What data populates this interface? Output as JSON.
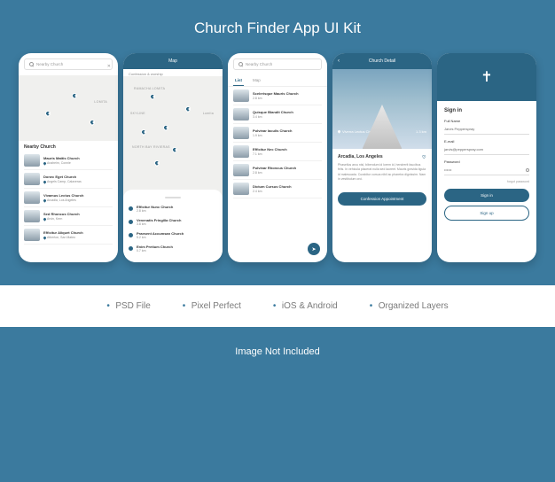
{
  "colors": {
    "brand": "#2b6584",
    "bg": "#3b7a9e"
  },
  "title": "Church Finder App UI Kit",
  "features": [
    "PSD File",
    "Pixel Perfect",
    "iOS & Android",
    "Organized Layers"
  ],
  "not_included": "Image Not Included",
  "screen1": {
    "search_placeholder": "Nearby Church",
    "section": "Nearby Church",
    "map_labels": [
      "LOMITA"
    ],
    "items": [
      {
        "name": "Mauris Mattis Church",
        "sub": "Anaheim, Connie"
      },
      {
        "name": "Donec Eget Church",
        "sub": "Angels Camp, Calaveras"
      },
      {
        "name": "Vivamus Lectus Church",
        "sub": "Arcadia, Los Angeles"
      },
      {
        "name": "Sed Rhoncus Church",
        "sub": "Arvin, Kern"
      },
      {
        "name": "Efficitur Aliquet Church",
        "sub": "Atherton, San Mateo"
      }
    ]
  },
  "screen2": {
    "header": "Map",
    "sub": "Confession & worship",
    "map_labels": [
      "RAMACHA LOMITA",
      "SKYLINE",
      "Lomita",
      "NORTH BAY RIVIERAS"
    ],
    "items": [
      {
        "name": "Efficitur Nunc Church",
        "dist": "2.8 km"
      },
      {
        "name": "Venenatis Fringilla Church",
        "dist": "3.8 km"
      },
      {
        "name": "Praesent Accumsan Church",
        "dist": "5.2 km"
      },
      {
        "name": "Enim Pretium Church",
        "dist": "0.7 km"
      }
    ]
  },
  "screen3": {
    "search_placeholder": "Nearby Church",
    "tabs": [
      "List",
      "Map"
    ],
    "items": [
      {
        "name": "Scelerisque Mauris Church",
        "dist": "2.8 km"
      },
      {
        "name": "Quisque Blandit Church",
        "dist": "3.4 km"
      },
      {
        "name": "Pulvinar Iaculis Church",
        "dist": "1.9 km"
      },
      {
        "name": "Efficitur Nec Church",
        "dist": "7.1 km"
      },
      {
        "name": "Pulvinar Rhoncus Church",
        "dist": "2.8 km"
      },
      {
        "name": "Dictum Cursus Church",
        "dist": "2.4 km"
      }
    ]
  },
  "screen4": {
    "header": "Church Detail",
    "marker": "Viverra Lectus Church",
    "dist": "1.3 km",
    "title": "Arcadia, Los Angeles",
    "body": "Phasellus arcu nisl, bibendum id lorem id, hendrerit faucibus felis. In vehicula placerat nulla sed laoreet. Mauris gravida ligula id malesuada. Curabitur cursus nibil ac pharetra dignissim. Nam in vestibulum orci.",
    "btn": "Confession Appointment"
  },
  "screen5": {
    "title": "Sign in",
    "full_name_label": "Full Name",
    "full_name_value": "Jarvis Pepperspray",
    "email_label": "E-mail",
    "email_value": "jarvis@pepperspray.com",
    "password_label": "Password",
    "password_value": "••••••",
    "forgot": "forgot password",
    "signin_btn": "Sign in",
    "signup_btn": "Sign up"
  }
}
